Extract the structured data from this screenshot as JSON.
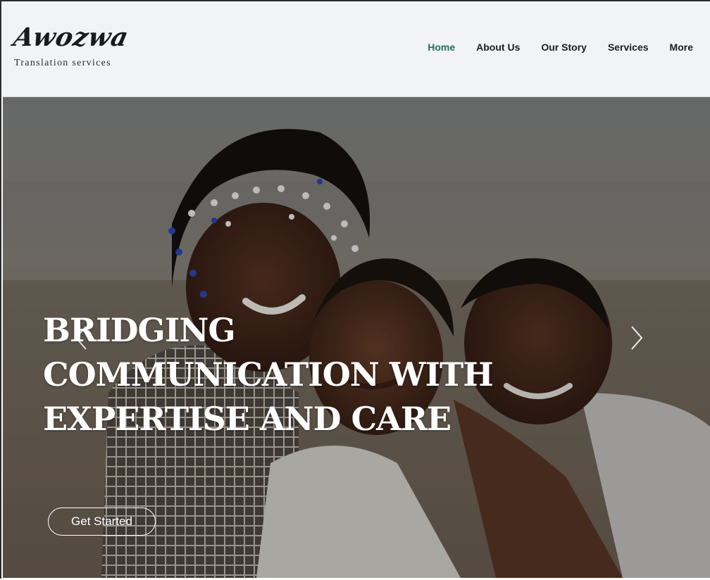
{
  "brand": {
    "name": "Awozwa",
    "tagline": "Translation services"
  },
  "nav": {
    "items": [
      {
        "label": "Home",
        "active": true
      },
      {
        "label": "About Us",
        "active": false
      },
      {
        "label": "Our Story",
        "active": false
      },
      {
        "label": "Services",
        "active": false
      },
      {
        "label": "More",
        "active": false
      }
    ]
  },
  "hero": {
    "title_lines": [
      "BRIDGING",
      "COMMUNICATION WITH",
      "EXPERTISE AND CARE"
    ],
    "cta_label": "Get Started",
    "image_icon": "photo-three-smiling-children-icon",
    "prev_icon": "chevron-left-icon",
    "next_icon": "chevron-right-icon"
  },
  "colors": {
    "header_bg": "#f2f3f4",
    "nav_active": "#1e6f5c",
    "nav_text": "#1b1b1b",
    "hero_text": "#ffffff"
  }
}
